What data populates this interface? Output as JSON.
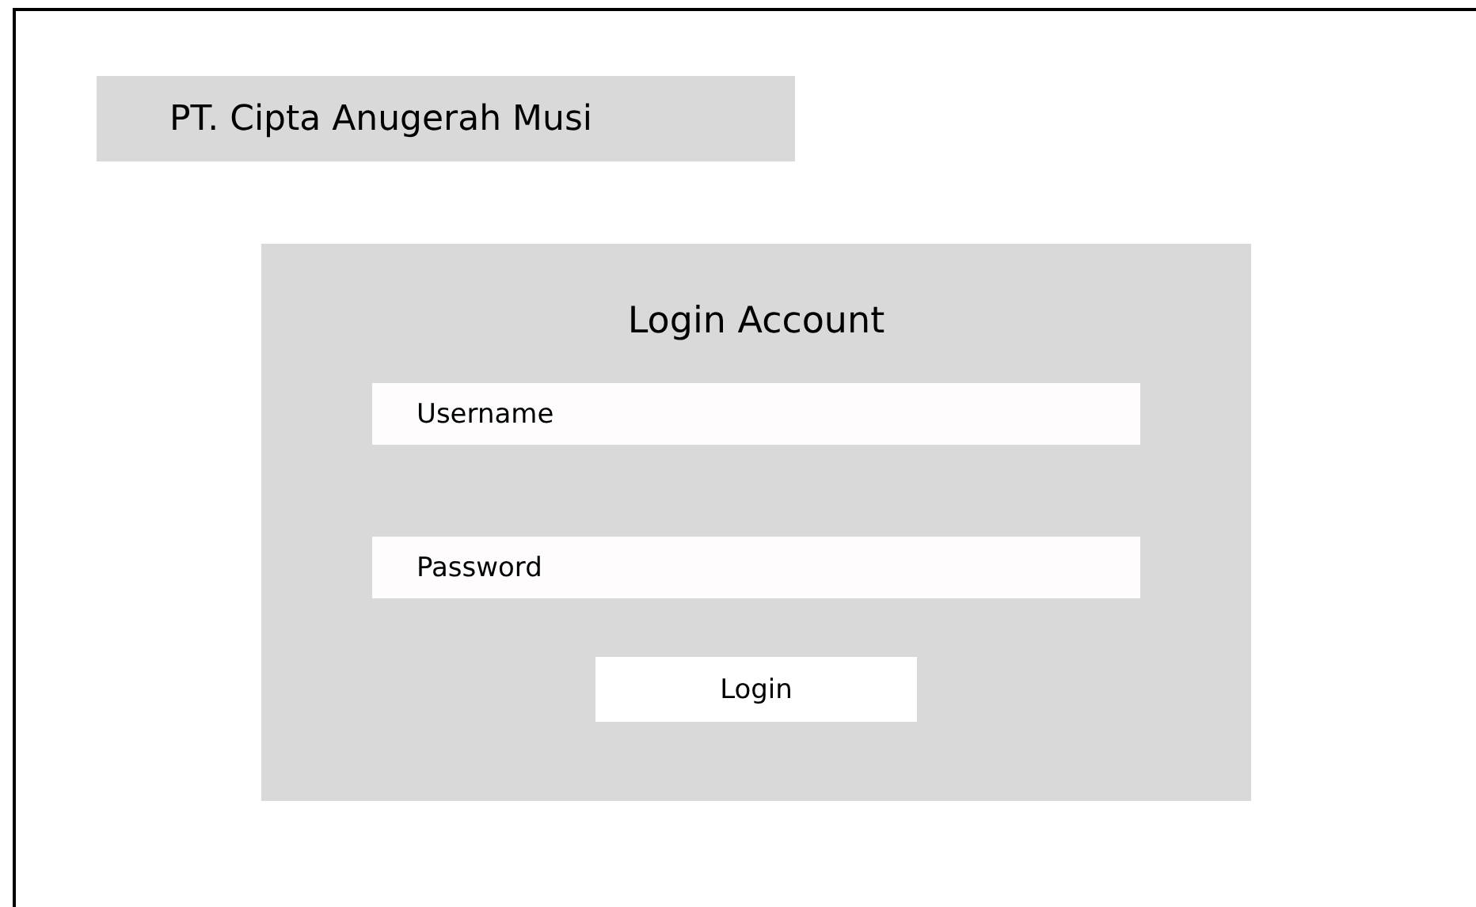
{
  "company": {
    "name": "PT. Cipta Anugerah Musi"
  },
  "login": {
    "title": "Login Account",
    "fields": [
      {
        "placeholder": "Username"
      },
      {
        "placeholder": "Password"
      }
    ],
    "button": "Login"
  }
}
